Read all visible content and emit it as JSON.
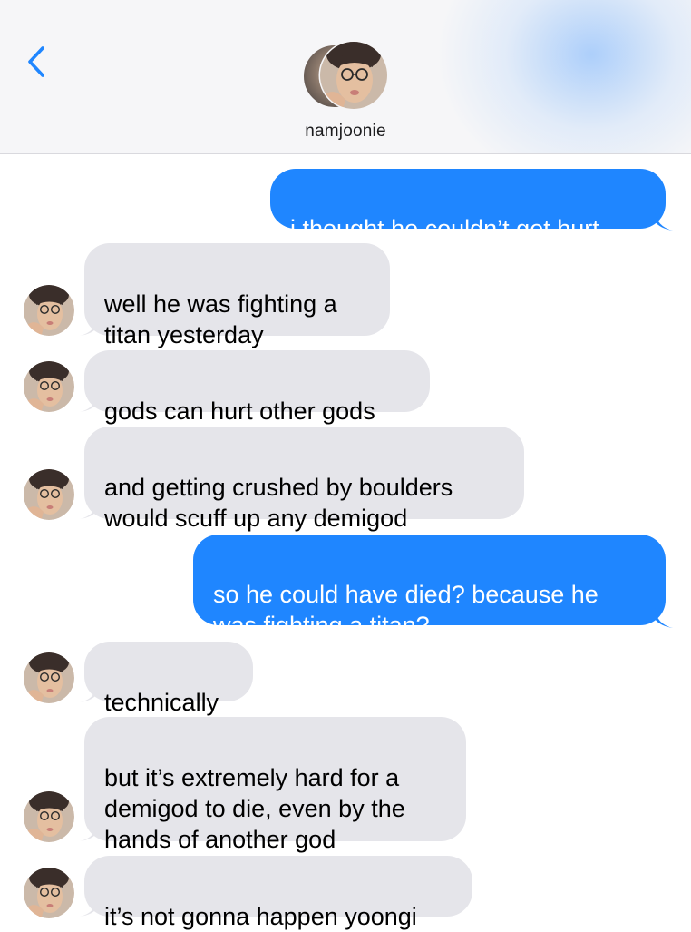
{
  "header": {
    "contact_name": "namjoonie",
    "back_icon": "chevron-left-icon",
    "accent": "#1f86ff"
  },
  "messages": [
    {
      "side": "out",
      "text": "i thought he couldn’t get hurt"
    },
    {
      "side": "in",
      "text": "well he was fighting a\ntitan yesterday"
    },
    {
      "side": "in",
      "text": "gods can hurt other gods"
    },
    {
      "side": "in",
      "text": "and getting crushed by boulders\nwould scuff up any demigod"
    },
    {
      "side": "out",
      "text": "so he could have died? because he\nwas fighting a titan?"
    },
    {
      "side": "in",
      "text": "technically"
    },
    {
      "side": "in",
      "text": "but it’s extremely hard for a\ndemigod to die, even by the\nhands of another god"
    },
    {
      "side": "in",
      "text": "it’s not gonna happen yoongi"
    }
  ],
  "colors": {
    "incoming_bubble": "#e5e5ea",
    "outgoing_bubble": "#1f86ff"
  }
}
